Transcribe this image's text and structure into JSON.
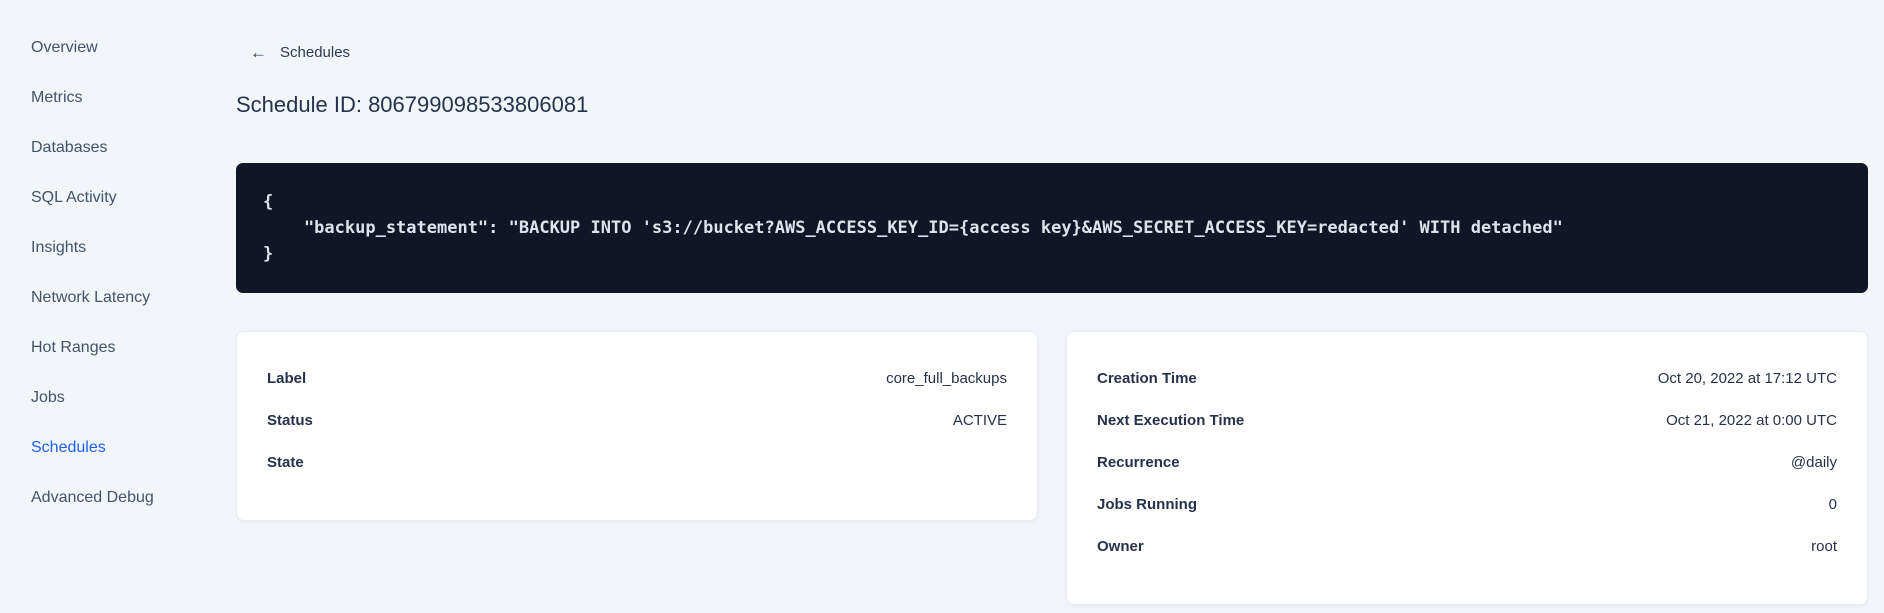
{
  "colors": {
    "accent_blue": "#2160f0",
    "code_block_bg": "#101627",
    "page_bg": "#f2f5f9"
  },
  "sidebar": {
    "items": [
      {
        "label": "Overview"
      },
      {
        "label": "Metrics"
      },
      {
        "label": "Databases"
      },
      {
        "label": "SQL Activity"
      },
      {
        "label": "Insights"
      },
      {
        "label": "Network Latency"
      },
      {
        "label": "Hot Ranges"
      },
      {
        "label": "Jobs"
      },
      {
        "label": "Schedules",
        "active": true
      },
      {
        "label": "Advanced Debug"
      }
    ]
  },
  "header": {
    "back_icon": "←",
    "back_label": "Schedules",
    "title": "Schedule ID: 806799098533806081"
  },
  "code_block": {
    "lines": [
      "{",
      "    \"backup_statement\": \"BACKUP INTO 's3://bucket?AWS_ACCESS_KEY_ID={access key}&AWS_SECRET_ACCESS_KEY=redacted' WITH detached\"",
      "}"
    ]
  },
  "details_card": {
    "rows": [
      {
        "label": "Label",
        "value": "core_full_backups"
      },
      {
        "label": "Status",
        "value": "ACTIVE"
      },
      {
        "label": "State",
        "value": ""
      }
    ]
  },
  "schedule_card": {
    "rows": [
      {
        "label": "Creation Time",
        "value": "Oct 20, 2022 at 17:12 UTC"
      },
      {
        "label": "Next Execution Time",
        "value": "Oct 21, 2022 at 0:00 UTC"
      },
      {
        "label": "Recurrence",
        "value": "@daily"
      },
      {
        "label": "Jobs Running",
        "value": "0"
      },
      {
        "label": "Owner",
        "value": "root"
      }
    ]
  }
}
